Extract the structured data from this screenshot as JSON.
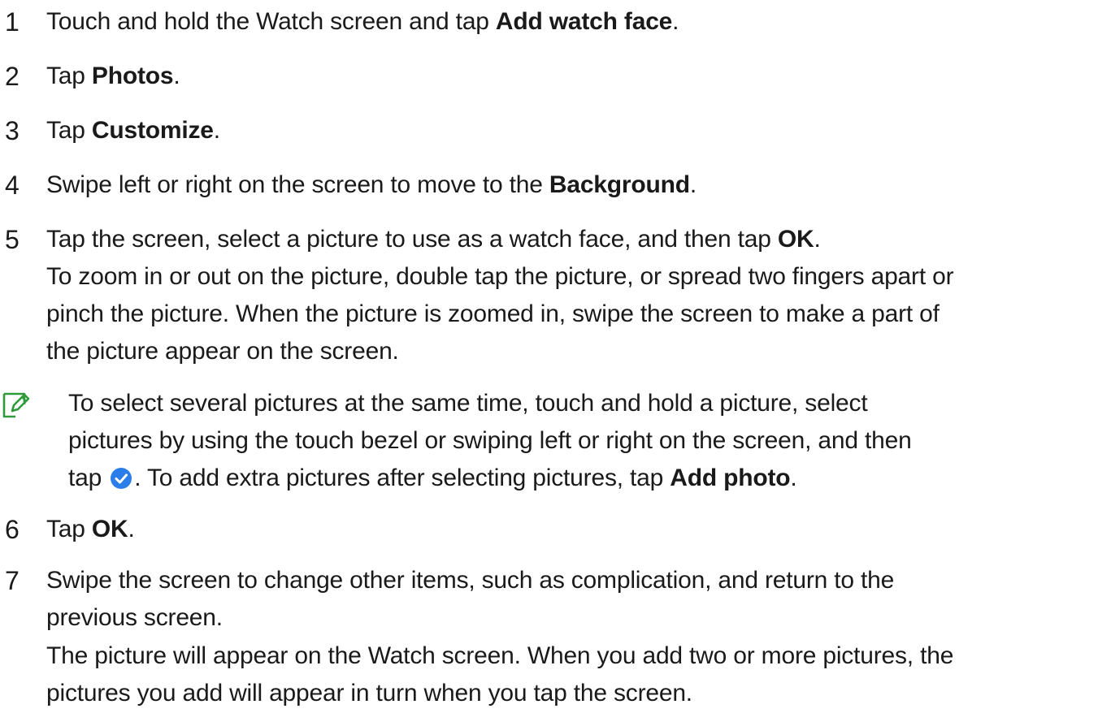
{
  "steps": [
    {
      "num": "1",
      "pre": "Touch and hold the Watch screen and tap ",
      "bold": "Add watch face",
      "post": "."
    },
    {
      "num": "2",
      "pre": "Tap ",
      "bold": "Photos",
      "post": "."
    },
    {
      "num": "3",
      "pre": "Tap ",
      "bold": "Customize",
      "post": "."
    },
    {
      "num": "4",
      "pre": "Swipe left or right on the screen to move to the ",
      "bold": "Background",
      "post": "."
    },
    {
      "num": "5",
      "pre": "Tap the screen, select a picture to use as a watch face, and then tap ",
      "bold": "OK",
      "post": "."
    },
    {
      "num": "6",
      "pre": "Tap ",
      "bold": "OK",
      "post": "."
    },
    {
      "num": "7",
      "line1": "Swipe the screen to change other items, such as complication, and return to the",
      "line2": "previous screen."
    }
  ],
  "step5_detail": {
    "line1": "To zoom in or out on the picture, double tap the picture, or spread two fingers apart or",
    "line2": "pinch the picture. When the picture is zoomed in, swipe the screen to make a part of",
    "line3": "the picture appear on the screen."
  },
  "note": {
    "icon": "note-icon",
    "line1": "To select several pictures at the same time, touch and hold a picture, select",
    "line2": "pictures by using the touch bezel or swiping left or right on the screen, and then",
    "line3_pre": "tap ",
    "check_icon": "check-circle-icon",
    "line3_post": ". To add extra pictures after selecting pictures, tap ",
    "line3_bold": "Add photo",
    "line3_end": "."
  },
  "step7_detail": {
    "line1": "The picture will appear on the Watch screen. When you add two or more pictures, the",
    "line2": "pictures you add will appear in turn when you tap the screen."
  },
  "colors": {
    "note_icon": "#2e9a3a",
    "check_icon": "#2b7de9",
    "text": "#1a1a1a"
  }
}
